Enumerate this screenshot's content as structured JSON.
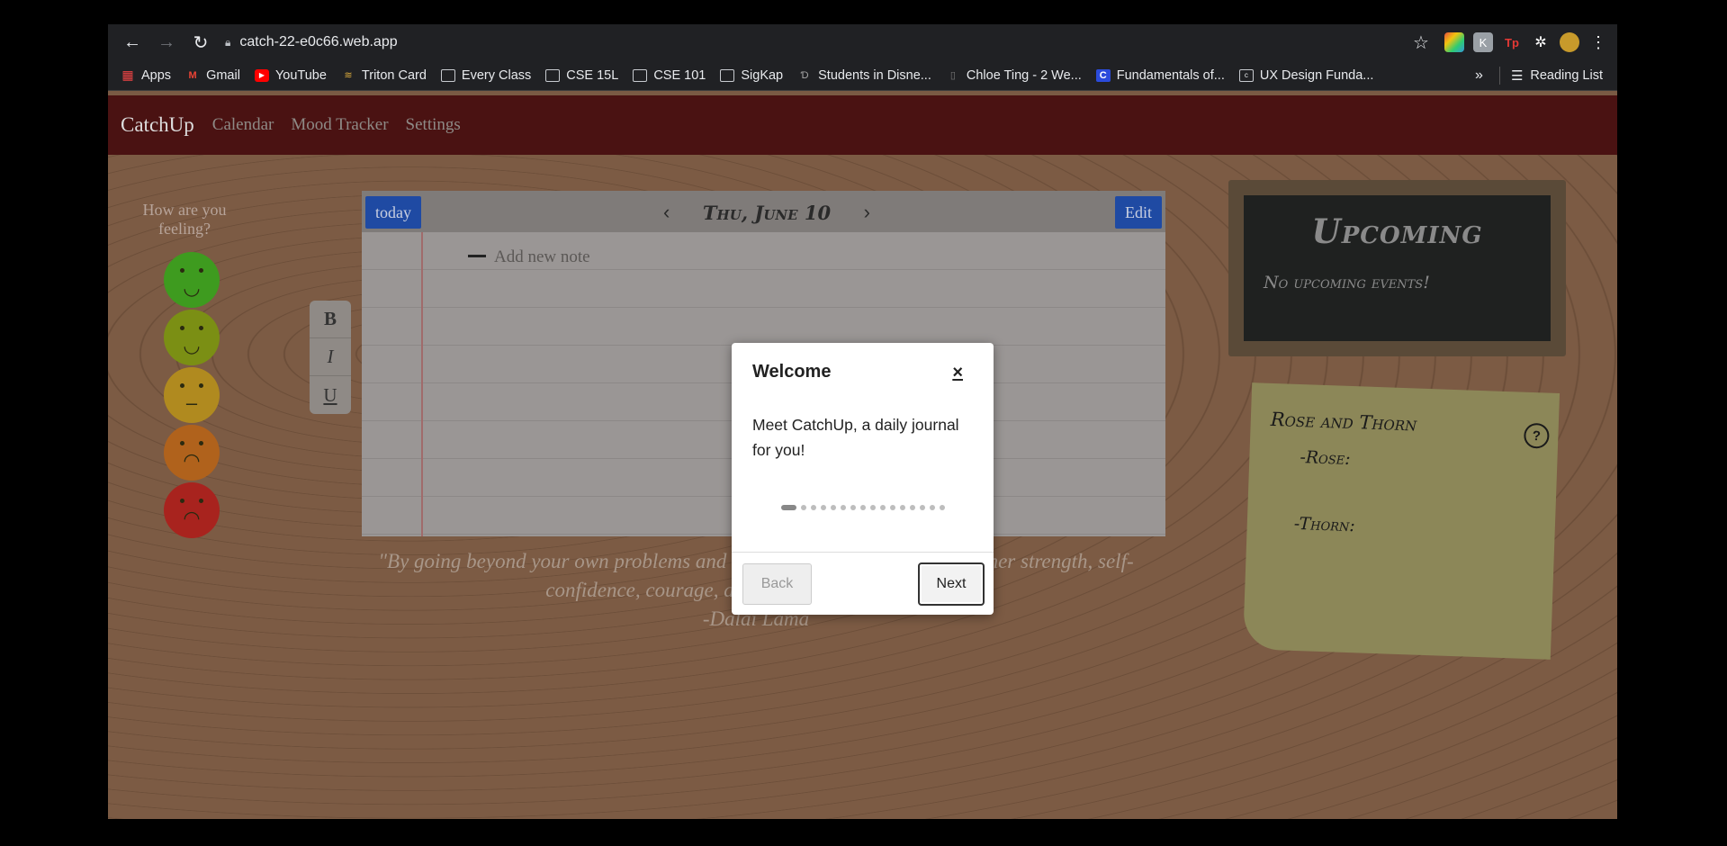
{
  "browser": {
    "url": "catch-22-e0c66.web.app",
    "bookmarks": [
      {
        "label": "Apps",
        "icon": "apps-grid-icon"
      },
      {
        "label": "Gmail",
        "icon": "gmail-icon"
      },
      {
        "label": "YouTube",
        "icon": "youtube-icon"
      },
      {
        "label": "Triton Card",
        "icon": "triton-icon"
      },
      {
        "label": "Every Class",
        "icon": "folder-icon"
      },
      {
        "label": "CSE 15L",
        "icon": "folder-icon"
      },
      {
        "label": "CSE 101",
        "icon": "folder-icon"
      },
      {
        "label": "SigKap",
        "icon": "folder-icon"
      },
      {
        "label": "Students in Disne...",
        "icon": "disney-icon"
      },
      {
        "label": "Chloe Ting - 2 We...",
        "icon": "page-icon"
      },
      {
        "label": "Fundamentals of...",
        "icon": "c-icon"
      },
      {
        "label": "UX Design Funda...",
        "icon": "course-icon"
      }
    ],
    "overflow": "»",
    "reading_list": "Reading List"
  },
  "app": {
    "brand": "CatchUp",
    "nav": [
      "Calendar",
      "Mood Tracker",
      "Settings"
    ]
  },
  "mood": {
    "prompt": "How are you feeling?",
    "faces": [
      {
        "name": "very-happy",
        "color": "#3e9b1f",
        "glyph": "◡"
      },
      {
        "name": "happy",
        "color": "#7b8f14",
        "glyph": "◡"
      },
      {
        "name": "neutral",
        "color": "#b08a1f",
        "glyph": "–"
      },
      {
        "name": "sad",
        "color": "#b0621c",
        "glyph": "◠"
      },
      {
        "name": "very-sad",
        "color": "#a8231e",
        "glyph": "◠"
      }
    ]
  },
  "formatting": {
    "bold": "B",
    "italic": "I",
    "underline": "U"
  },
  "journal": {
    "today_label": "today",
    "date": "Thu, June 10",
    "prev": "‹",
    "next": "›",
    "edit_label": "Edit",
    "new_note": "Add new note"
  },
  "quote": {
    "line1": "\"By going beyond your own problems and taki",
    "line1_end": "ner strength, self-",
    "line2": "confidence, courage, and a greater sense of calm.\"",
    "author": "-Dalai Lama"
  },
  "upcoming": {
    "title": "Upcoming",
    "empty": "No upcoming events!"
  },
  "rose_thorn": {
    "title": "Rose and Thorn",
    "rose": "-Rose:",
    "thorn": "-Thorn:",
    "help": "?"
  },
  "modal": {
    "title": "Welcome",
    "close": "×",
    "body": "Meet CatchUp, a daily journal for you!",
    "step_count": 16,
    "active_step": 1,
    "back_label": "Back",
    "next_label": "Next"
  }
}
